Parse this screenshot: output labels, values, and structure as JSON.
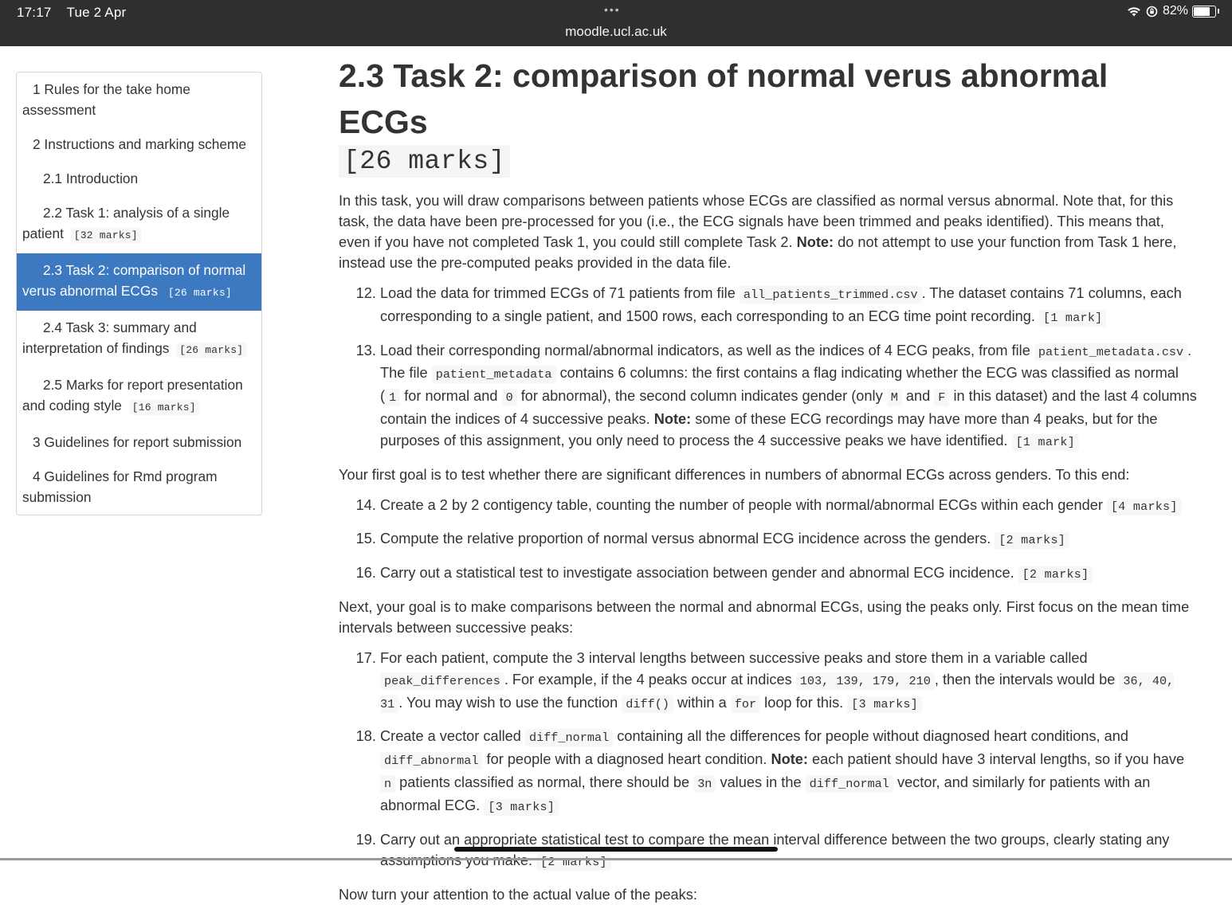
{
  "status": {
    "time": "17:17",
    "date": "Tue 2 Apr",
    "dots": "•••",
    "url": "moodle.ucl.ac.uk",
    "battery": "82%",
    "battery_level": 0.82,
    "icons": [
      "wifi-icon",
      "screen-rotation-lock-icon",
      "battery-icon"
    ]
  },
  "toc": {
    "items": [
      {
        "label": "1 Rules for the take home assessment",
        "marks": ""
      },
      {
        "label": "2 Instructions and marking scheme",
        "marks": ""
      },
      {
        "label": "2.1 Introduction",
        "marks": ""
      },
      {
        "label": "2.2 Task 1: analysis of a single patient",
        "marks": "[32 marks]"
      },
      {
        "label": "2.3 Task 2: comparison of normal verus abnormal ECGs",
        "marks": "[26 marks]"
      },
      {
        "label": "2.4 Task 3: summary and interpretation of findings",
        "marks": "[26 marks]"
      },
      {
        "label": "2.5 Marks for report presentation and coding style",
        "marks": "[16 marks]"
      },
      {
        "label": "3 Guidelines for report submission",
        "marks": ""
      },
      {
        "label": "4 Guidelines for Rmd program submission",
        "marks": ""
      }
    ]
  },
  "main": {
    "title": "2.3 Task 2: comparison of normal verus abnormal ECGs",
    "title_marks": "[26 marks]",
    "intro": {
      "t1": "In this task, you will draw comparisons between patients whose ECGs are classified as normal versus abnormal. Note that, for this task, the data have been pre-processed for you (i.e., the ECG signals have been trimmed and peaks identified). This means that, even if you have not completed Task 1, you could still complete Task 2. ",
      "note": "Note:",
      "t2": " do not attempt to use your function from Task 1 here, instead use the pre-computed peaks provided in the data file."
    },
    "item12": {
      "t1": "Load the data for trimmed ECGs of 71 patients from file ",
      "c1": "all_patients_trimmed.csv",
      "t2": ". The dataset contains 71 columns, each corresponding to a single patient, and 1500 rows, each corresponding to an ECG time point recording. ",
      "marks": "[1 mark]"
    },
    "item13": {
      "t1": "Load their corresponding normal/abnormal indicators, as well as the indices of 4 ECG peaks, from file ",
      "c1": "patient_metadata.csv",
      "t2": ". The file ",
      "c2": "patient_metadata",
      "t3": " contains 6 columns: the first contains a flag indicating whether the ECG was classified as normal (",
      "c3": "1",
      "t4": " for normal and ",
      "c4": "0",
      "t5": " for abnormal), the second column indicates gender (only ",
      "c5": "M",
      "t6": " and ",
      "c6": "F",
      "t7": " in this dataset) and the last 4 columns contain the indices of 4 successive peaks. ",
      "note": "Note:",
      "t8": " some of these ECG recordings may have more than 4 peaks, but for the purposes of this assignment, you only need to process the 4 successive peaks we have identified. ",
      "marks": "[1 mark]"
    },
    "para_goal1": "Your first goal is to test whether there are significant differences in numbers of abnormal ECGs across genders. To this end:",
    "item14": {
      "t1": "Create a 2 by 2 contigency table, counting the number of people with normal/abnormal ECGs within each gender ",
      "marks": "[4 marks]"
    },
    "item15": {
      "t1": "Compute the relative proportion of normal versus abnormal ECG incidence across the genders. ",
      "marks": "[2 marks]"
    },
    "item16": {
      "t1": "Carry out a statistical test to investigate association between gender and abnormal ECG incidence. ",
      "marks": "[2 marks]"
    },
    "para_goal2": "Next, your goal is to make comparisons between the normal and abnormal ECGs, using the peaks only. First focus on the mean time intervals between successive peaks:",
    "item17": {
      "t1": "For each patient, compute the 3 interval lengths between successive peaks and store them in a variable called ",
      "c1": "peak_differences",
      "t2": ". For example, if the 4 peaks occur at indices ",
      "c2": "103, 139, 179, 210",
      "t3": ", then the intervals would be ",
      "c3": "36, 40, 31",
      "t4": ". You may wish to use the function ",
      "c4": "diff()",
      "t5": " within a ",
      "c5": "for",
      "t6": " loop for this. ",
      "marks": "[3 marks]"
    },
    "item18": {
      "t1": "Create a vector called ",
      "c1": "diff_normal",
      "t2": " containing all the differences for people without diagnosed heart conditions, and ",
      "c2": "diff_abnormal",
      "t3": " for people with a diagnosed heart condition. ",
      "note": "Note:",
      "t4": " each patient should have 3 interval lengths, so if you have ",
      "c3": "n",
      "t5": " patients classified as normal, there should be ",
      "c4": "3n",
      "t6": " values in the ",
      "c5": "diff_normal",
      "t7": " vector, and similarly for patients with an abnormal ECG. ",
      "marks": "[3 marks]"
    },
    "item19": {
      "t1": "Carry out an appropriate statistical test to compare the mean interval difference between the two groups, clearly stating any assumptions you make. ",
      "marks": "[2 marks]"
    },
    "para_next": "Now turn your attention to the actual value of the peaks:"
  },
  "colors": {
    "topbar": "#2f2f2f",
    "active_toc": "#3d79c0",
    "text": "#333333",
    "code_bg": "#f7f7f7"
  }
}
